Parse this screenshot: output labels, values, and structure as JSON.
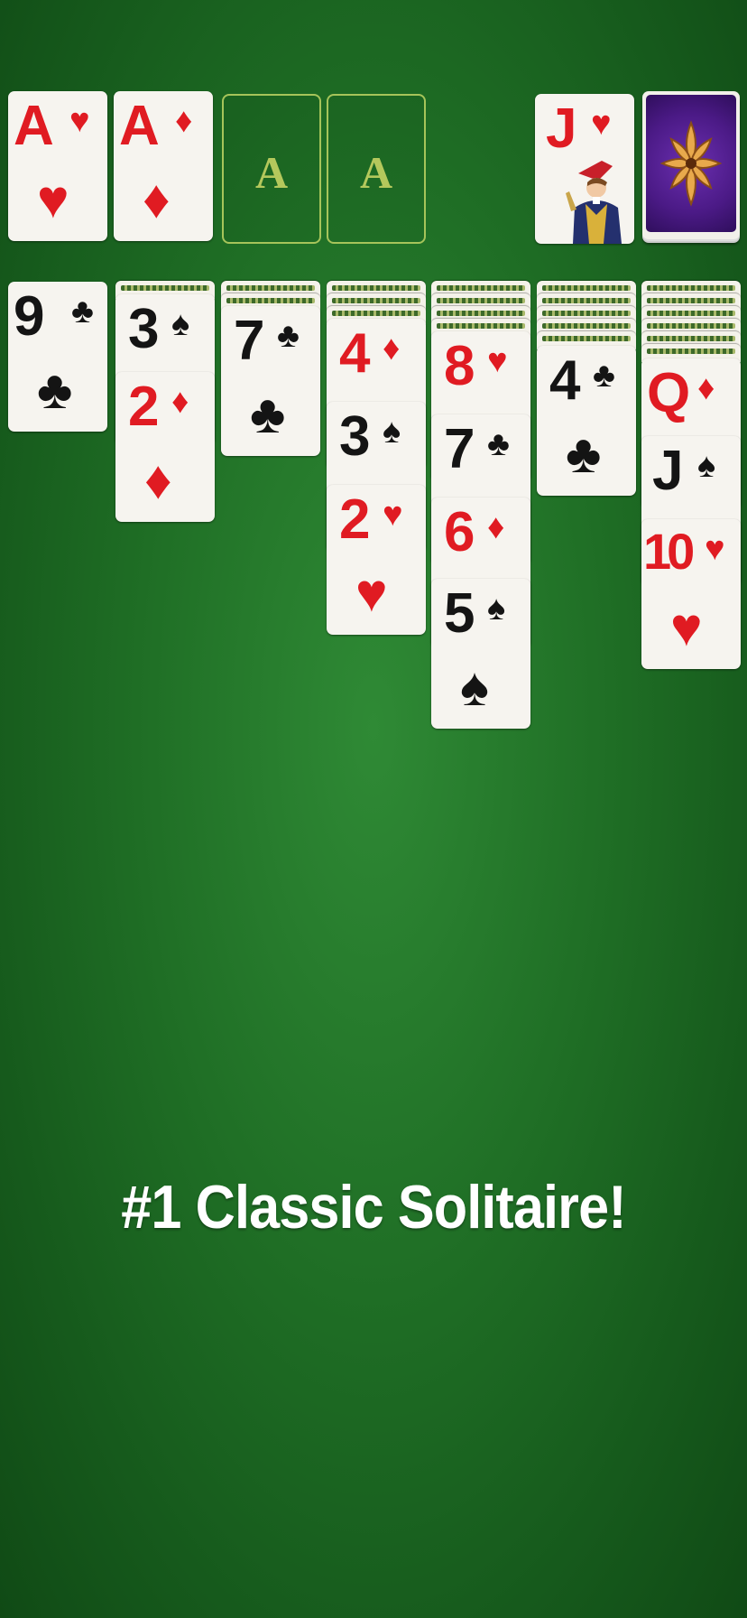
{
  "foundations": [
    {
      "rank": "A",
      "suit": "♥",
      "color": "red"
    },
    {
      "rank": "A",
      "suit": "♦",
      "color": "red"
    },
    {
      "label": "A"
    },
    {
      "label": "A"
    }
  ],
  "waste": {
    "rank": "J",
    "suit": "♥",
    "color": "red"
  },
  "stock": {
    "icon": "card-back-flower-icon"
  },
  "tableau": {
    "col1": [
      {
        "rank": "9",
        "suit": "♣",
        "color": "black"
      }
    ],
    "col2": [
      {
        "rank": "3",
        "suit": "♠",
        "color": "black"
      },
      {
        "rank": "2",
        "suit": "♦",
        "color": "red"
      }
    ],
    "col3": [
      {
        "rank": "7",
        "suit": "♣",
        "color": "black"
      }
    ],
    "col4": [
      {
        "rank": "4",
        "suit": "♦",
        "color": "red"
      },
      {
        "rank": "3",
        "suit": "♠",
        "color": "black"
      },
      {
        "rank": "2",
        "suit": "♥",
        "color": "red"
      }
    ],
    "col5": [
      {
        "rank": "8",
        "suit": "♥",
        "color": "red"
      },
      {
        "rank": "7",
        "suit": "♣",
        "color": "black"
      },
      {
        "rank": "6",
        "suit": "♦",
        "color": "red"
      },
      {
        "rank": "5",
        "suit": "♠",
        "color": "black"
      }
    ],
    "col6": [
      {
        "rank": "4",
        "suit": "♣",
        "color": "black"
      }
    ],
    "col7": [
      {
        "rank": "Q",
        "suit": "♦",
        "color": "red"
      },
      {
        "rank": "J",
        "suit": "♠",
        "color": "black"
      },
      {
        "rank": "10",
        "suit": "♥",
        "color": "red"
      }
    ]
  },
  "tagline": "#1 Classic Solitaire!",
  "colors": {
    "felt": "#1f6e25",
    "red_suit": "#e01b22",
    "black_suit": "#141414",
    "slot_outline": "#a6c45a",
    "card_back": "#4b1a86"
  }
}
